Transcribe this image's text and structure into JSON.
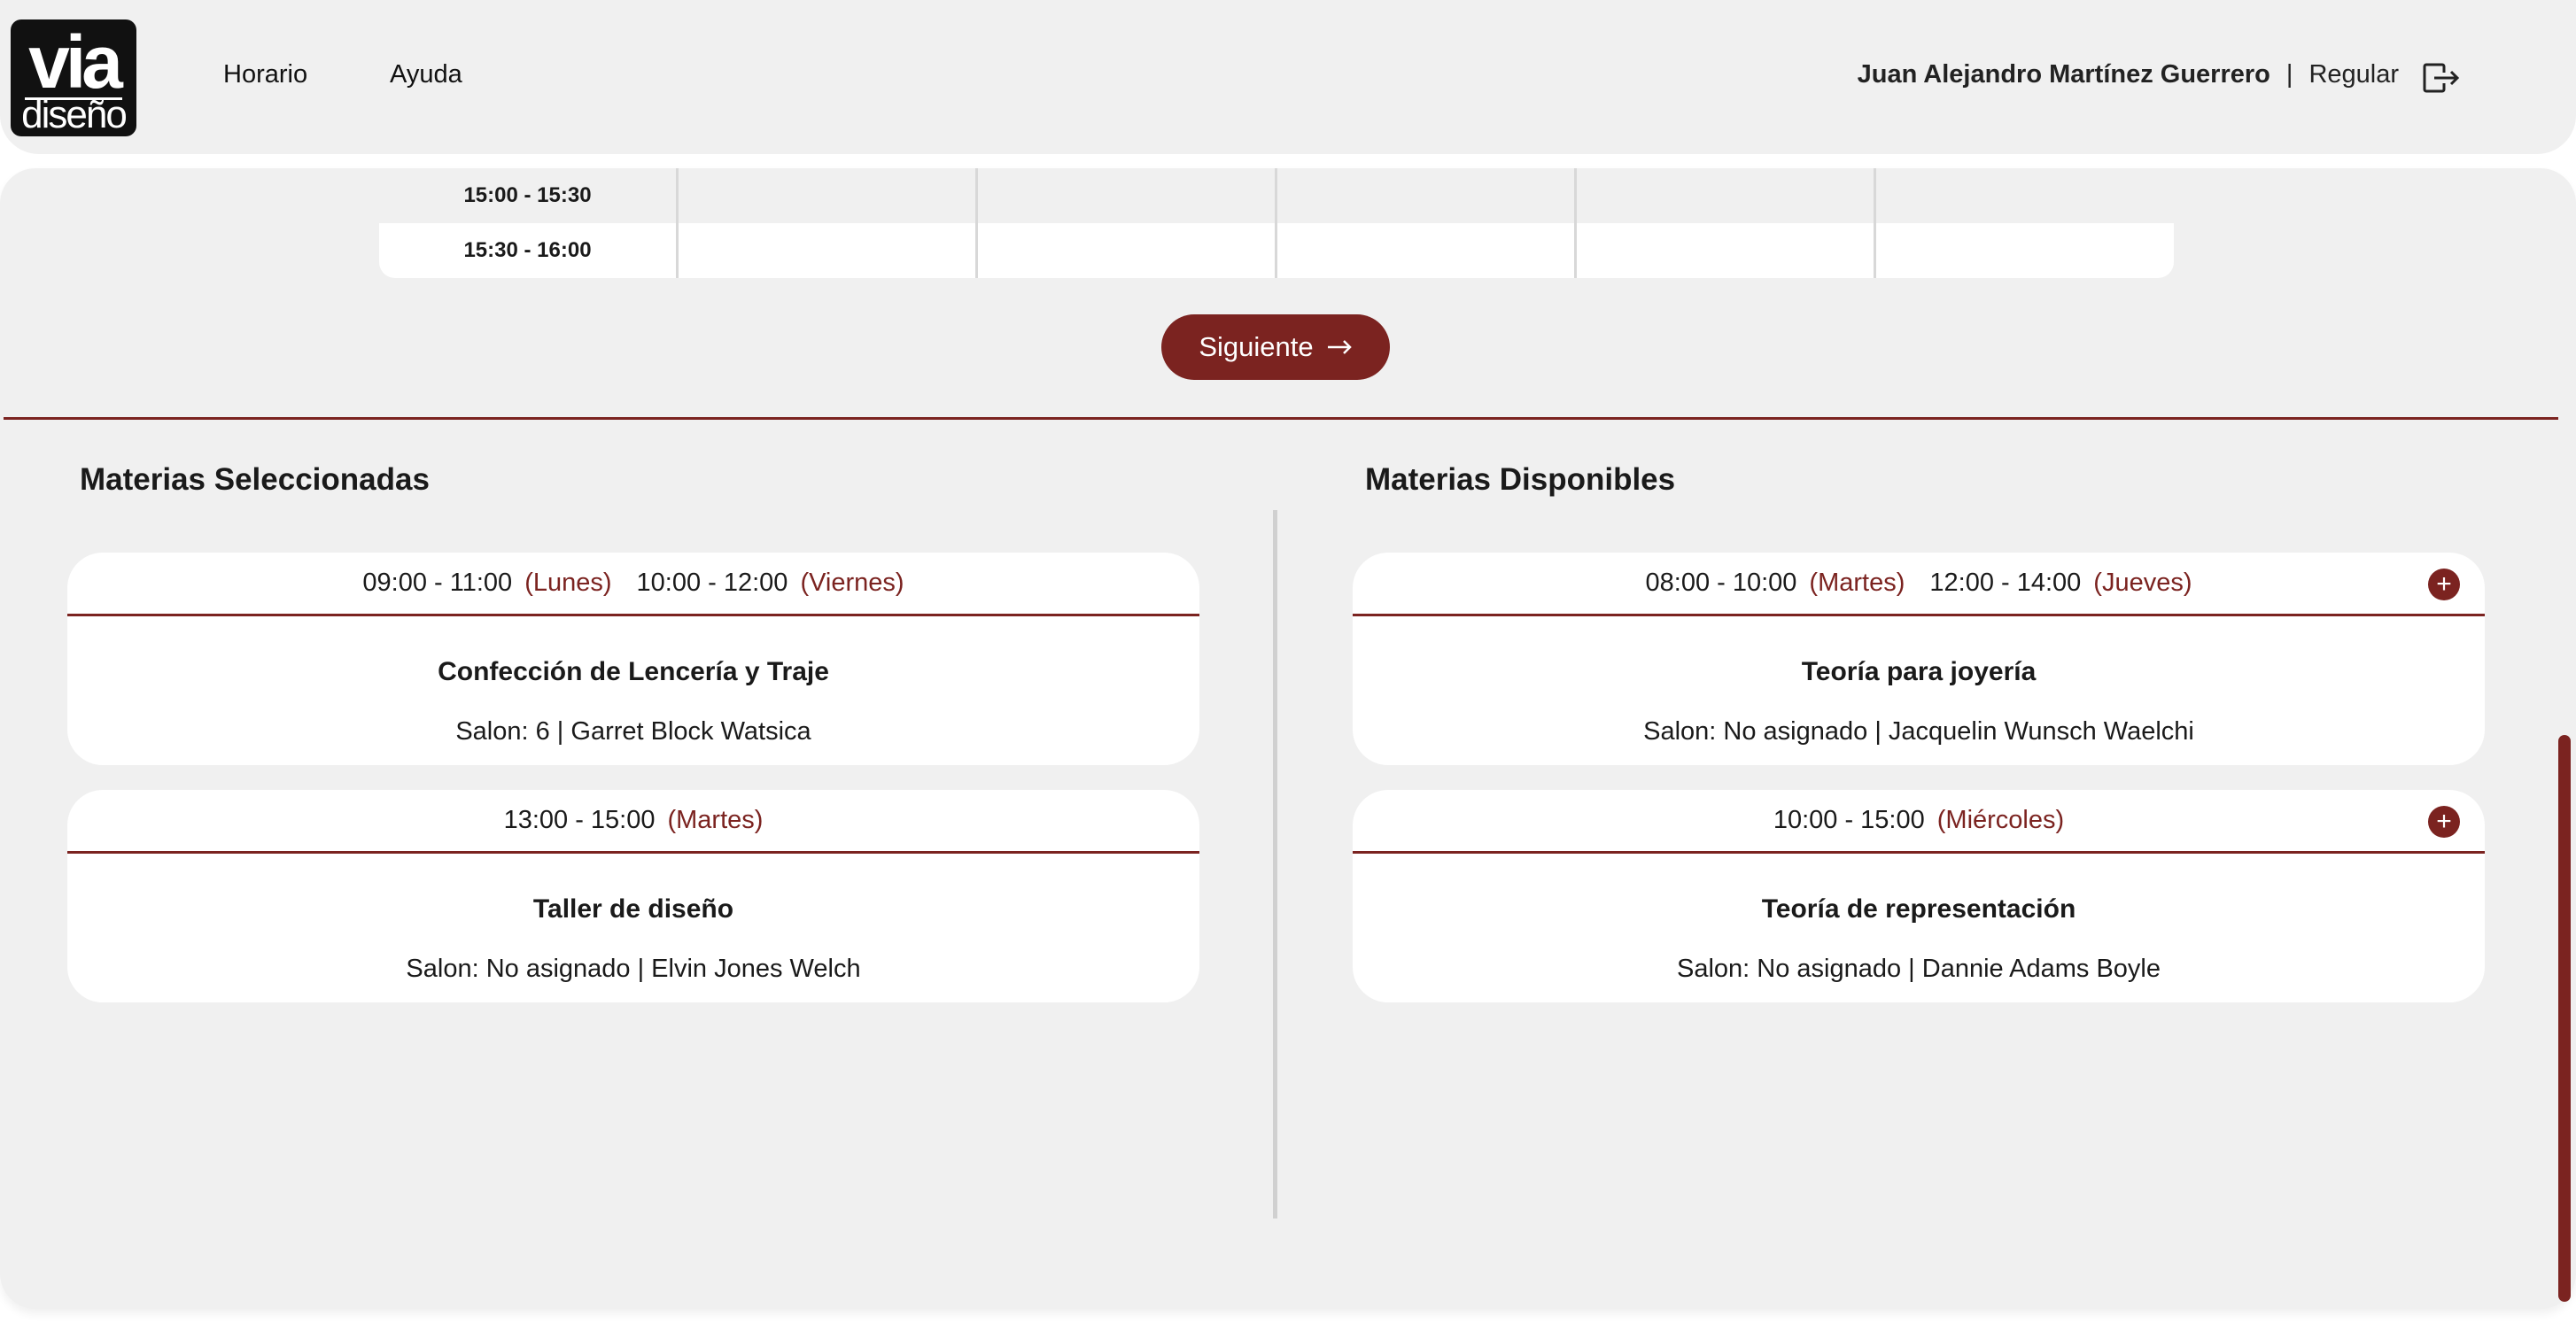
{
  "header": {
    "logo_top": "via",
    "logo_bottom": "diseño",
    "nav": [
      "Horario",
      "Ayuda"
    ],
    "user_name": "Juan Alejandro Martínez Guerrero",
    "separator": "|",
    "user_type": "Regular"
  },
  "schedule": {
    "rows": [
      {
        "time": "15:00 - 15:30"
      },
      {
        "time": "15:30 - 16:00"
      }
    ]
  },
  "next_button": {
    "label": "Siguiente",
    "icon": "arrow-right-icon"
  },
  "selected": {
    "title": "Materias Seleccionadas",
    "items": [
      {
        "slots": [
          {
            "time": "09:00 - 11:00",
            "day": "(Lunes)"
          },
          {
            "time": "10:00 - 12:00",
            "day": "(Viernes)"
          }
        ],
        "name": "Confección de Lencería y Traje",
        "info": "Salon: 6 | Garret Block Watsica"
      },
      {
        "slots": [
          {
            "time": "13:00 - 15:00",
            "day": "(Martes)"
          }
        ],
        "name": "Taller de diseño",
        "info": "Salon: No asignado | Elvin Jones Welch"
      }
    ]
  },
  "available": {
    "title": "Materias Disponibles",
    "items": [
      {
        "slots": [
          {
            "time": "08:00 - 10:00",
            "day": "(Martes)"
          },
          {
            "time": "12:00 - 14:00",
            "day": "(Jueves)"
          }
        ],
        "name": "Teoría para joyería",
        "info": "Salon: No asignado | Jacquelin Wunsch Waelchi",
        "add_icon": "plus-circle-icon"
      },
      {
        "slots": [
          {
            "time": "10:00 - 15:00",
            "day": "(Miércoles)"
          }
        ],
        "name": "Teoría de representación",
        "info": "Salon: No asignado | Dannie Adams Boyle",
        "add_icon": "plus-circle-icon"
      }
    ]
  },
  "colors": {
    "accent": "#7b2320",
    "panel": "#f0f0f0"
  }
}
